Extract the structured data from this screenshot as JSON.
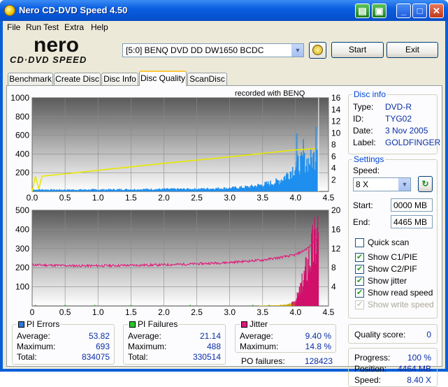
{
  "window": {
    "title": "Nero CD-DVD Speed 4.50",
    "icon": "nero-disc-icon"
  },
  "menu": [
    "File",
    "Run Test",
    "Extra",
    "Help"
  ],
  "logo": {
    "word": "nero",
    "sub": "CD·DVD SPEED"
  },
  "drive": {
    "selected": "[5:0]  BENQ DVD DD DW1650 BCDC"
  },
  "buttons": {
    "start": "Start",
    "exit": "Exit"
  },
  "tabs": [
    "Benchmark",
    "Create Disc",
    "Disc Info",
    "Disc Quality",
    "ScanDisc"
  ],
  "active_tab": "Disc Quality",
  "chart_annotation": "recorded with BENQ",
  "disc_info": {
    "title": "Disc info",
    "rows": [
      {
        "label": "Type:",
        "value": "DVD-R"
      },
      {
        "label": "ID:",
        "value": "TYG02"
      },
      {
        "label": "Date:",
        "value": "3 Nov 2005"
      },
      {
        "label": "Label:",
        "value": "GOLDFINGER"
      }
    ]
  },
  "settings": {
    "title": "Settings",
    "speed_label": "Speed:",
    "speed_value": "8 X",
    "start_label": "Start:",
    "start_value": "0000 MB",
    "end_label": "End:",
    "end_value": "4465 MB",
    "checkboxes": [
      {
        "label": "Quick scan",
        "checked": false,
        "disabled": false
      },
      {
        "label": "Show C1/PIE",
        "checked": true,
        "disabled": false
      },
      {
        "label": "Show C2/PIF",
        "checked": true,
        "disabled": false
      },
      {
        "label": "Show jitter",
        "checked": true,
        "disabled": false
      },
      {
        "label": "Show read speed",
        "checked": true,
        "disabled": false
      },
      {
        "label": "Show write speed",
        "checked": true,
        "disabled": true
      }
    ]
  },
  "quality_score": {
    "label": "Quality score:",
    "value": "0"
  },
  "progress": {
    "rows": [
      {
        "label": "Progress:",
        "value": "100 %"
      },
      {
        "label": "Position:",
        "value": "4464 MB"
      },
      {
        "label": "Speed:",
        "value": "8.40 X"
      }
    ]
  },
  "pi_errors": {
    "title": "PI Errors",
    "color": "#2a7ae2",
    "rows": [
      {
        "label": "Average:",
        "value": "53.82"
      },
      {
        "label": "Maximum:",
        "value": "693"
      },
      {
        "label": "Total:",
        "value": "834075"
      }
    ]
  },
  "pi_failures": {
    "title": "PI Failures",
    "color": "#2cc42c",
    "rows": [
      {
        "label": "Average:",
        "value": "21.14"
      },
      {
        "label": "Maximum:",
        "value": "488"
      },
      {
        "label": "Total:",
        "value": "330514"
      }
    ]
  },
  "jitter": {
    "title": "Jitter",
    "color": "#e0187a",
    "rows": [
      {
        "label": "Average:",
        "value": "9.40 %"
      },
      {
        "label": "Maximum:",
        "value": "14.8 %"
      }
    ]
  },
  "po_failures": {
    "label": "PO failures:",
    "value": "128423"
  },
  "colors": {
    "pie": "#1e8fee",
    "read_speed": "#e8e800",
    "pif": "#d0106a",
    "jitter": "#e0187a",
    "accent": "#0046d5"
  },
  "chart_data": [
    {
      "type": "area",
      "name": "PI Errors / read speed",
      "x_ticks": [
        "0.0",
        "0.5",
        "1.0",
        "1.5",
        "2.0",
        "2.5",
        "3.0",
        "3.5",
        "4.0",
        "4.5"
      ],
      "xlim": [
        0,
        4.5
      ],
      "ylim": [
        0,
        1000
      ],
      "y_ticks": [
        "200",
        "400",
        "600",
        "800",
        "1000"
      ],
      "y2lim": [
        0,
        16
      ],
      "y2_ticks": [
        "2",
        "4",
        "6",
        "8",
        "10",
        "12",
        "14",
        "16"
      ],
      "pie_envelope": {
        "x": [
          0,
          0.5,
          1.0,
          1.5,
          2.0,
          2.5,
          3.0,
          3.3,
          3.5,
          3.7,
          3.8,
          3.9,
          4.0,
          4.05,
          4.1,
          4.15,
          4.2,
          4.25,
          4.3,
          4.35
        ],
        "y": [
          22,
          20,
          22,
          25,
          28,
          30,
          40,
          55,
          80,
          110,
          150,
          220,
          300,
          330,
          340,
          350,
          360,
          380,
          420,
          693
        ]
      },
      "pie_spikes": [
        {
          "x": 4.02,
          "y": 620
        },
        {
          "x": 4.12,
          "y": 560
        },
        {
          "x": 4.31,
          "y": 693
        }
      ],
      "read_speed": {
        "x": [
          0,
          0.05,
          0.1,
          0.15,
          0.5,
          1.0,
          2.0,
          3.0,
          3.5,
          4.0,
          4.3
        ],
        "y": [
          0,
          2.6,
          0.4,
          2.6,
          3.0,
          3.6,
          4.8,
          5.9,
          6.5,
          7.1,
          7.3
        ]
      },
      "grid": true
    },
    {
      "type": "bar",
      "name": "PI Failures / jitter",
      "x_ticks": [
        "0",
        "0.5",
        "1.0",
        "1.5",
        "2.0",
        "2.5",
        "3.0",
        "3.5",
        "4.0",
        "4.5"
      ],
      "xlim": [
        0,
        4.5
      ],
      "ylim": [
        0,
        500
      ],
      "y_ticks": [
        "100",
        "200",
        "300",
        "400",
        "500"
      ],
      "y2lim": [
        0,
        20
      ],
      "y2_ticks": [
        "4",
        "8",
        "12",
        "16",
        "20"
      ],
      "pif": {
        "x": [
          3.5,
          3.7,
          3.8,
          3.9,
          3.95,
          4.0,
          4.05,
          4.1,
          4.15,
          4.2,
          4.25,
          4.3,
          4.35
        ],
        "y": [
          2,
          4,
          6,
          10,
          18,
          40,
          80,
          150,
          220,
          300,
          360,
          420,
          488
        ]
      },
      "jitter": {
        "x": [
          0,
          0.3,
          0.6,
          1.0,
          1.5,
          2.0,
          2.5,
          3.0,
          3.5,
          3.8,
          4.0,
          4.1,
          4.2,
          4.3,
          4.35
        ],
        "y": [
          8.6,
          8.5,
          8.4,
          8.4,
          8.5,
          8.6,
          8.8,
          9.1,
          9.6,
          10.2,
          10.7,
          11.4,
          12.2,
          13.8,
          14.8
        ]
      },
      "grid": true
    }
  ]
}
